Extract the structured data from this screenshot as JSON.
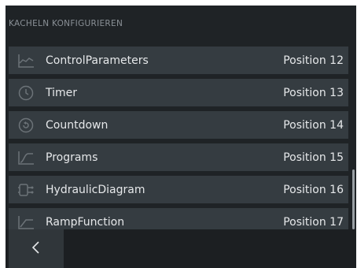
{
  "header": {
    "title": "KACHELN KONFIGURIEREN"
  },
  "tiles": [
    {
      "label": "ControlParameters",
      "position": "Position 12",
      "icon": "line-chart-icon"
    },
    {
      "label": "Timer",
      "position": "Position 13",
      "icon": "clock-icon"
    },
    {
      "label": "Countdown",
      "position": "Position 14",
      "icon": "countdown-icon"
    },
    {
      "label": "Programs",
      "position": "Position 15",
      "icon": "program-curve-icon"
    },
    {
      "label": "HydraulicDiagram",
      "position": "Position 16",
      "icon": "hydraulic-diagram-icon"
    },
    {
      "label": "RampFunction",
      "position": "Position 17",
      "icon": "ramp-icon"
    }
  ],
  "footer": {
    "back_icon": "chevron-left-icon"
  },
  "colors": {
    "background": "#1f2326",
    "row": "#353c41",
    "text": "#e6e8ea",
    "header_text": "#8a9096"
  }
}
